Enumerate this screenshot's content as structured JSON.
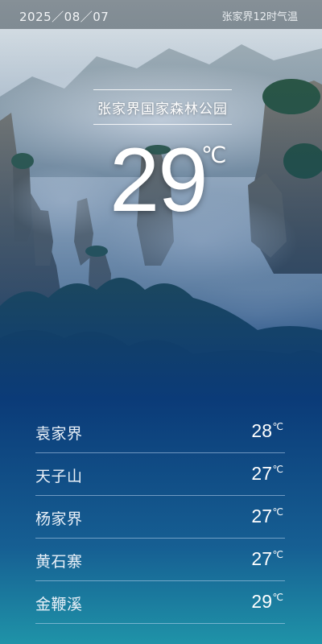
{
  "status": {
    "date": "2025／08／07",
    "subtitle": "张家界12时气温"
  },
  "location": {
    "name": "张家界国家森林公园",
    "temperature": "29",
    "unit": "℃"
  },
  "spots": [
    {
      "name": "袁家界",
      "temperature": "28",
      "unit": "℃"
    },
    {
      "name": "天子山",
      "temperature": "27",
      "unit": "℃"
    },
    {
      "name": "杨家界",
      "temperature": "27",
      "unit": "℃"
    },
    {
      "name": "黄石寨",
      "temperature": "27",
      "unit": "℃"
    },
    {
      "name": "金鞭溪",
      "temperature": "29",
      "unit": "℃"
    }
  ],
  "colors": {
    "sky": "#e6ecef",
    "mist": "#f3f5f6",
    "rock": "#6f6a5c",
    "forest": "#2f5a3c",
    "deep_blue": "#0b3b78",
    "teal_bottom": "#1f93a8"
  }
}
